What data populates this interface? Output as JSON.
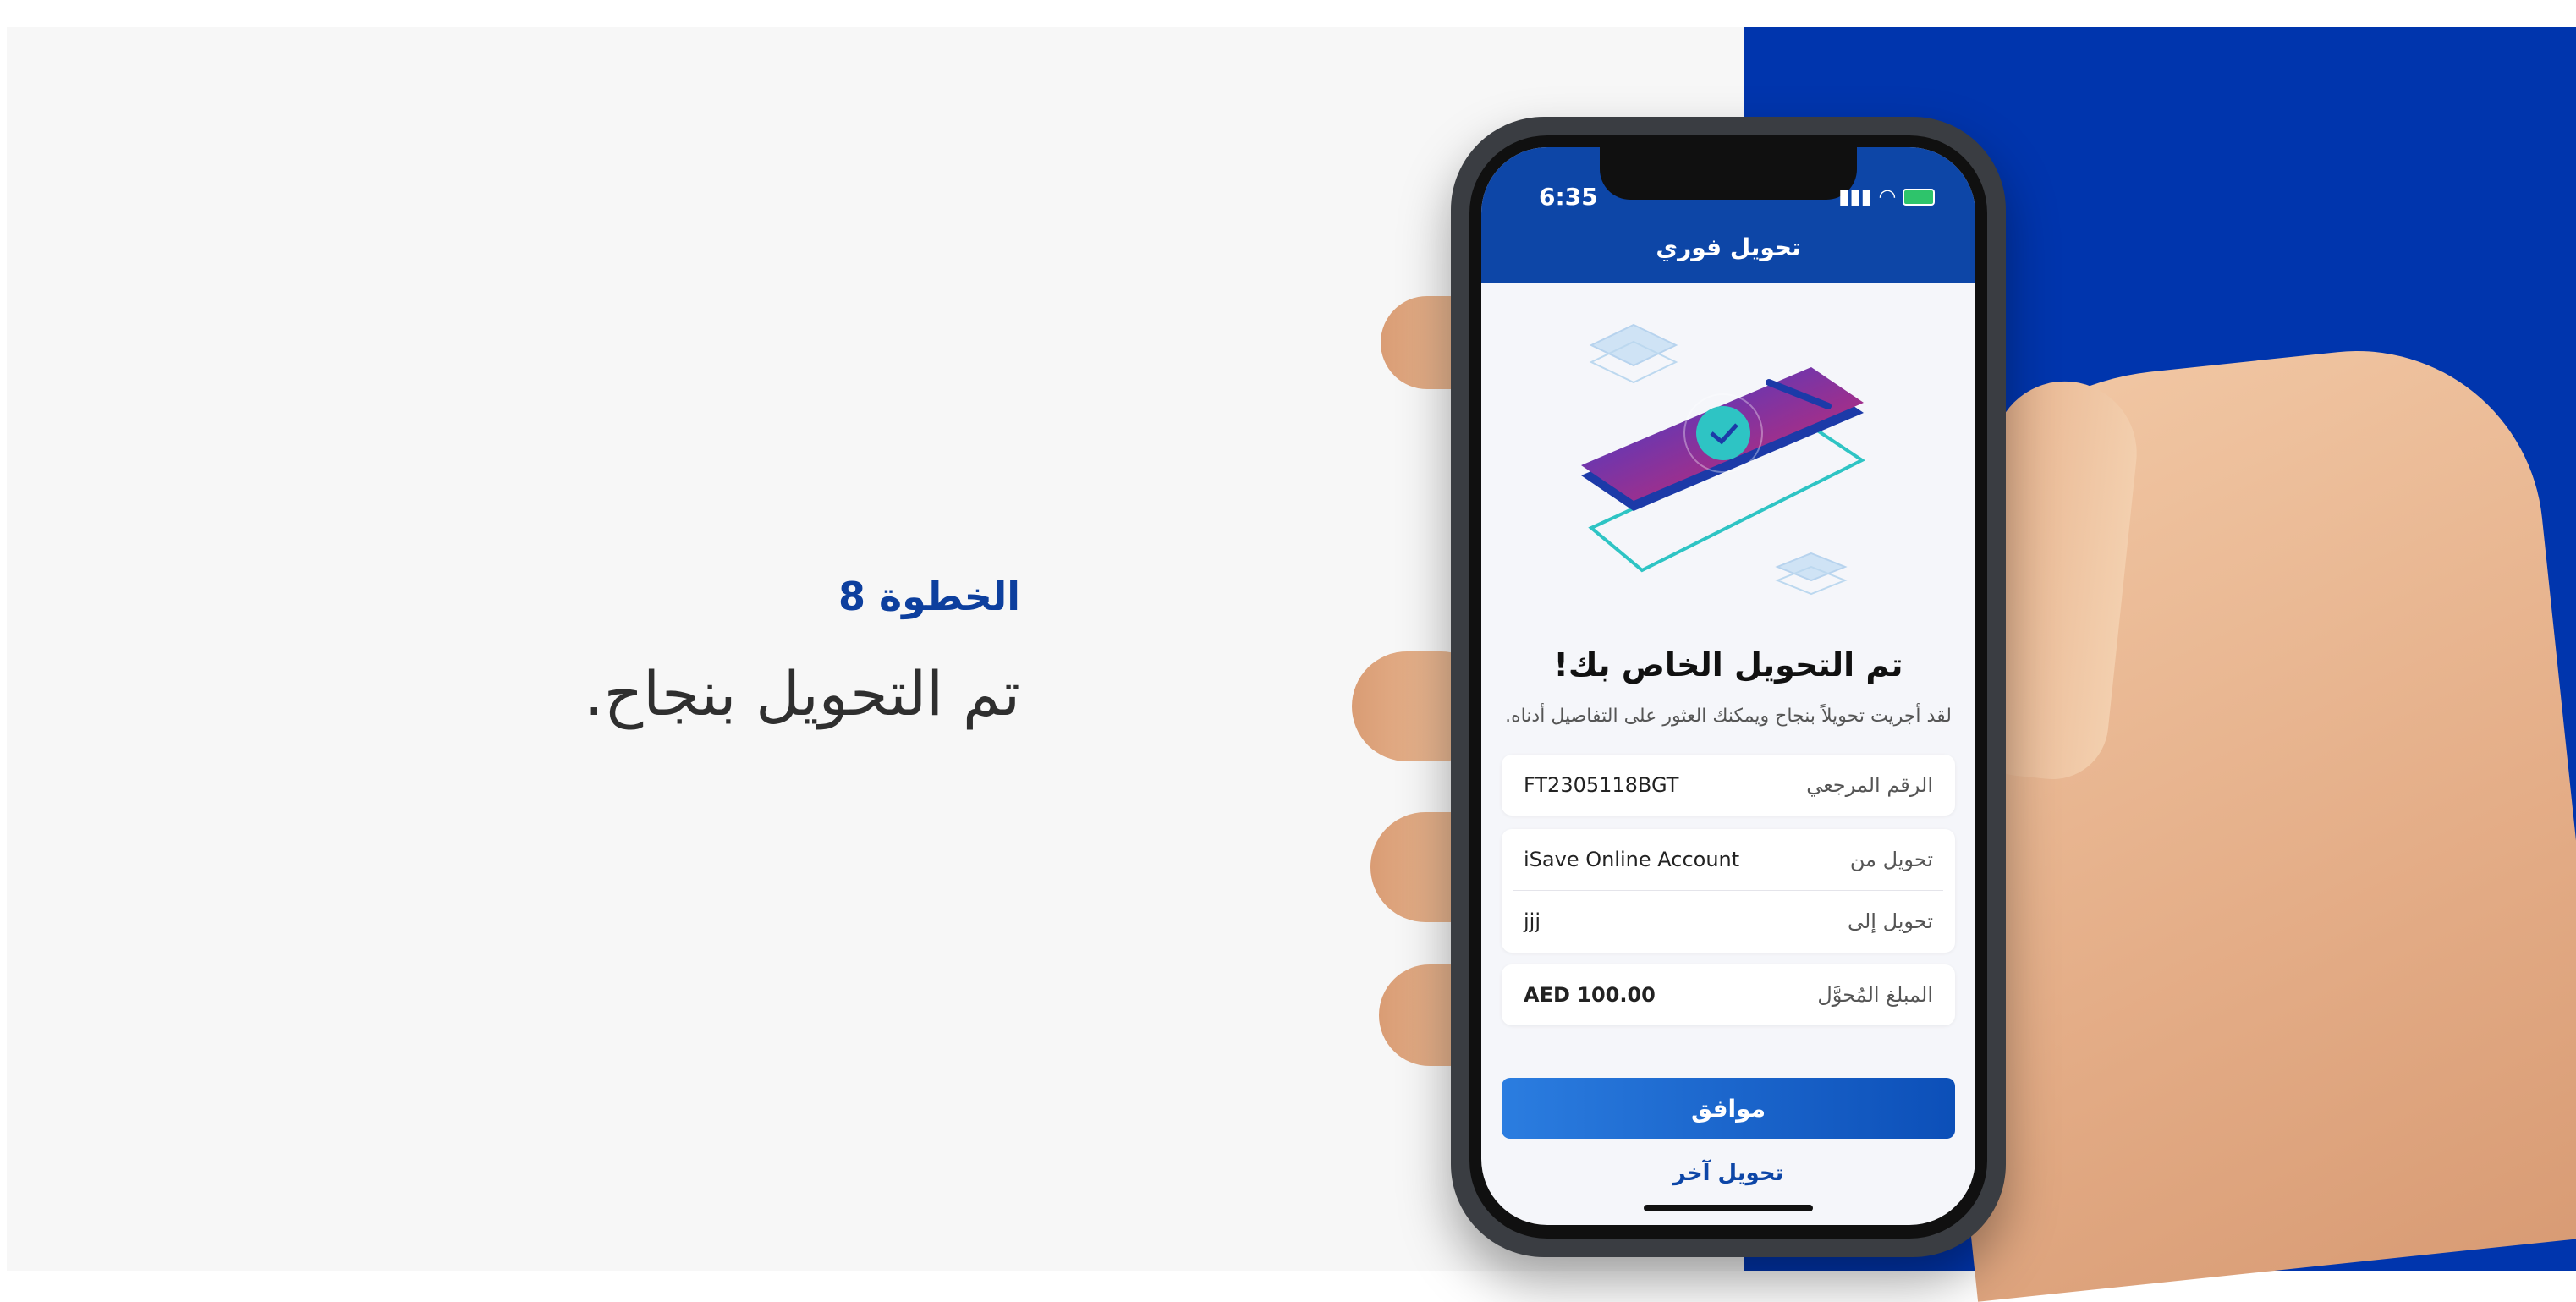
{
  "left": {
    "step_label": "الخطوة 8",
    "heading": "تم التحويل بنجاح."
  },
  "phone": {
    "status": {
      "time": "6:35"
    },
    "nav_title": "تحويل فوري",
    "success_title": "تم التحويل الخاص بك!",
    "success_subtitle": "لقد أجريت تحويلاً بنجاح ويمكنك العثور على التفاصيل أدناه.",
    "details": {
      "reference_label": "الرقم المرجعي",
      "reference_value": "FT2305118BGT",
      "from_label": "تحويل من",
      "from_value": "iSave Online Account",
      "to_label": "تحويل إلى",
      "to_value": "jjj",
      "amount_label": "المبلغ المُحوَّل",
      "amount_value": "AED 100.00"
    },
    "buttons": {
      "ok": "موافق",
      "another_transfer": "تحويل آخر"
    }
  },
  "colors": {
    "brand_blue": "#0035ad",
    "header_blue": "#0d46a7",
    "accent_teal": "#2ec4c4"
  }
}
